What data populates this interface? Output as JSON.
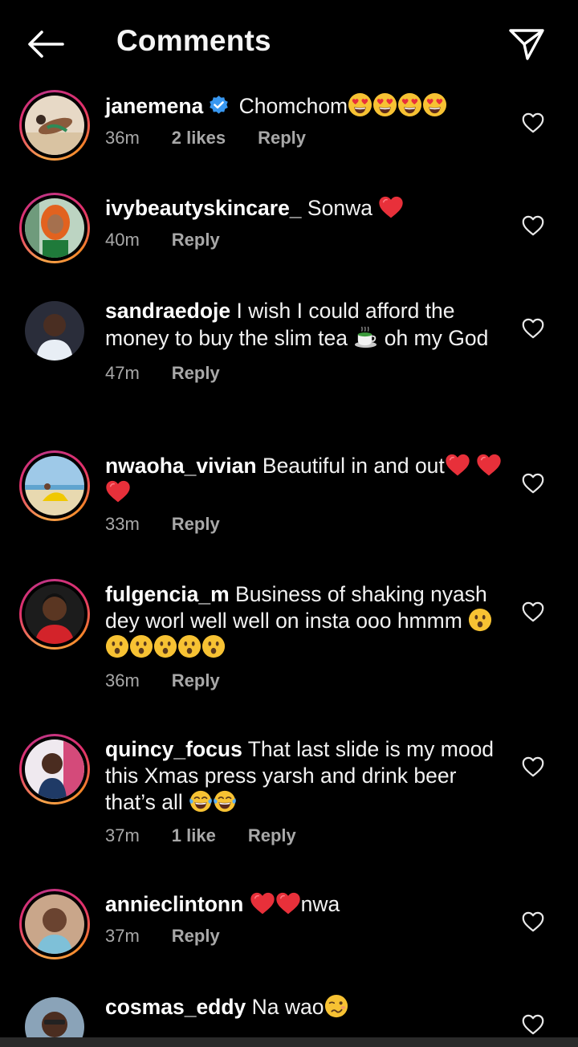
{
  "header": {
    "title": "Comments",
    "back_icon": "arrow-left-icon",
    "share_icon": "paper-plane-icon"
  },
  "colors": {
    "background": "#000000",
    "text": "#f5f5f5",
    "meta": "#a8a8a8",
    "verified": "#3897f0",
    "heart": "#e8303a"
  },
  "comments": [
    {
      "username": "janemena",
      "verified": true,
      "text": "Chomchom",
      "emoji": "heart-eyes-emoji x4",
      "time": "36m",
      "likes": "2 likes",
      "reply": "Reply"
    },
    {
      "username": "ivybeautyskincare_",
      "text": "Sonwa",
      "emoji": "red-heart-emoji",
      "time": "40m",
      "reply": "Reply"
    },
    {
      "username": "sandraedoje",
      "text_a": "I wish I could afford the money to buy the slim tea",
      "text_b": "oh my God",
      "emoji": "tea-emoji",
      "time": "47m",
      "reply": "Reply"
    },
    {
      "username": "nwaoha_vivian",
      "text": "Beautiful in and out",
      "emoji": "red-heart-emoji x3",
      "time": "33m",
      "reply": "Reply"
    },
    {
      "username": "fulgencia_m",
      "text": "Business of shaking nyash dey worl well well on insta ooo hmmm",
      "emoji": "surprised-face-emoji x6",
      "time": "36m",
      "reply": "Reply"
    },
    {
      "username": "quincy_focus",
      "text": "That last slide is my mood this Xmas press yarsh and drink beer that’s all",
      "emoji": "tears-of-joy-emoji x2",
      "time": "37m",
      "likes": "1 like",
      "reply": "Reply"
    },
    {
      "username": "annieclintonn",
      "emoji": "red-heart-emoji x2",
      "text": "nwa",
      "time": "37m",
      "reply": "Reply"
    },
    {
      "username": "cosmas_eddy",
      "text": "Na wao",
      "emoji": "woozy-face-emoji",
      "time": ""
    }
  ],
  "icons": {
    "like": "heart-outline-icon",
    "verified": "verified-badge-icon"
  }
}
